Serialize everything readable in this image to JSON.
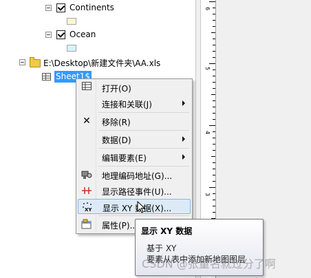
{
  "toc": {
    "layers": [
      {
        "label": "Continents",
        "swatch_color": "#fbf7d2"
      },
      {
        "label": "Ocean",
        "swatch_color": "#d6f4fb"
      }
    ],
    "workspace_path": "E:\\Desktop\\新建文件夹\\AA.xls",
    "selected_table": "Sheet1$"
  },
  "ruler": {
    "numbers": [
      "6",
      "5",
      "4",
      "3"
    ]
  },
  "context_menu": {
    "items": [
      {
        "label": "打开(O)",
        "icon": "table-icon",
        "submenu": false
      },
      {
        "label": "连接和关联(J)",
        "icon": "",
        "submenu": true
      },
      {
        "label": "移除(R)",
        "icon": "remove-x-icon",
        "submenu": false
      },
      {
        "label": "数据(D)",
        "icon": "",
        "submenu": true
      },
      {
        "label": "编辑要素(E)",
        "icon": "",
        "submenu": true
      },
      {
        "label": "地理编码地址(G)...",
        "icon": "geocode-icon",
        "submenu": false
      },
      {
        "label": "显示路径事件(U)...",
        "icon": "route-event-icon",
        "submenu": false
      },
      {
        "label": "显示 XY 数据(X)...",
        "icon": "xy-data-icon",
        "submenu": false,
        "highlighted": true
      },
      {
        "label": "属性(P)...",
        "icon": "properties-icon",
        "submenu": false
      }
    ]
  },
  "tooltip": {
    "title": "显示 XY 数据",
    "description": "基于 XY\n要素从表中添加新地图图层"
  },
  "watermark": "CSDN @张量名就过分了啊",
  "colors": {
    "selection": "#3399ff",
    "menu_highlight": "#dceaf8",
    "menu_bg": "#f0f0f0"
  }
}
